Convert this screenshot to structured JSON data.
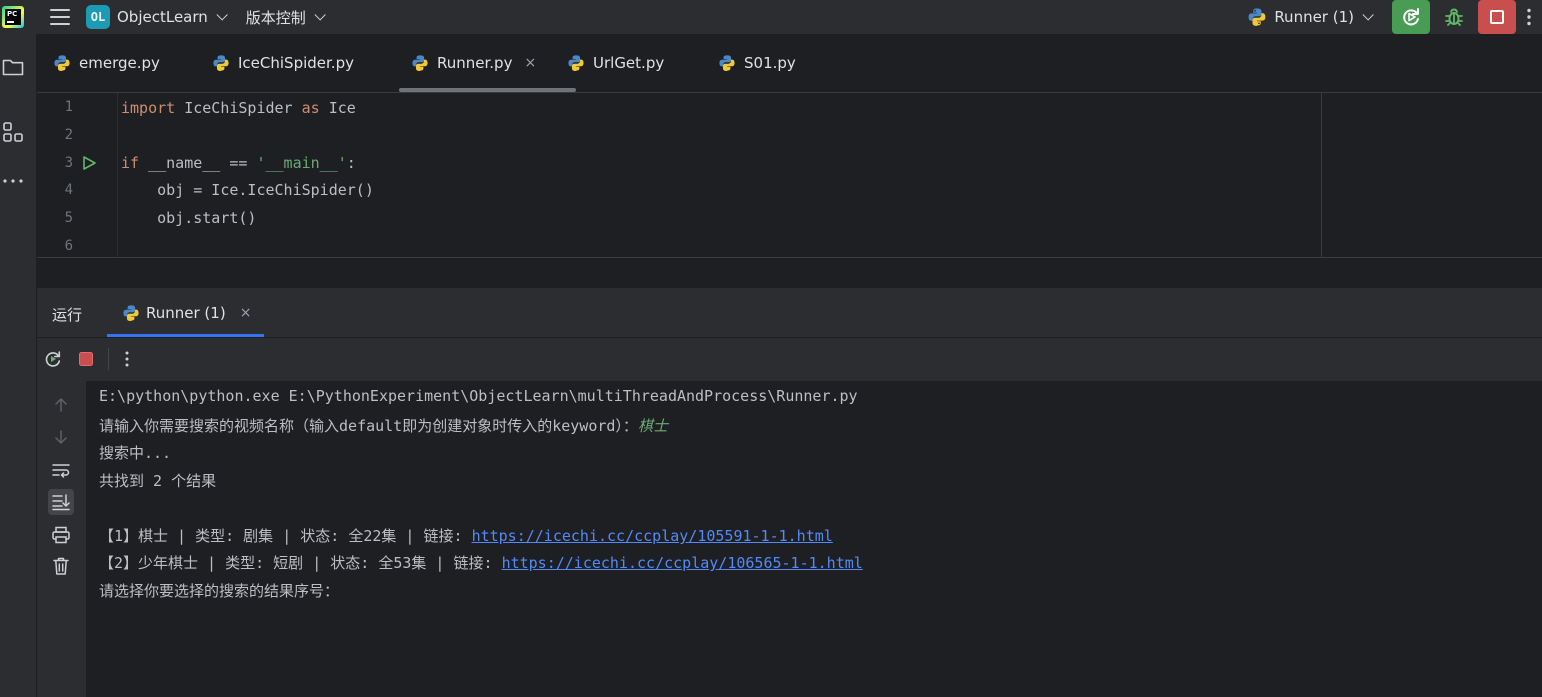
{
  "titlebar": {
    "project_badge": "OL",
    "project_name": "ObjectLearn",
    "vcs_label": "版本控制",
    "run_config": "Runner (1)"
  },
  "tabs": [
    {
      "label": "emerge.py",
      "active": false
    },
    {
      "label": "IceChiSpider.py",
      "active": false
    },
    {
      "label": "Runner.py",
      "active": true,
      "close": "×"
    },
    {
      "label": "UrlGet.py",
      "active": false
    },
    {
      "label": "S01.py",
      "active": false
    }
  ],
  "editor": {
    "line_numbers": [
      "1",
      "2",
      "3",
      "4",
      "5",
      "6"
    ],
    "lines": {
      "l1_kw1": "import",
      "l1_rest": " IceChiSpider ",
      "l1_kw2": "as",
      "l1_tail": " Ice",
      "l3_kw": "if",
      "l3_mid": " __name__ == ",
      "l3_str": "'__main__'",
      "l3_tail": ":",
      "l4": "    obj = Ice.IceChiSpider()",
      "l5": "    obj.start()"
    }
  },
  "run_panel": {
    "title": "运行",
    "tab_label": "Runner (1)",
    "tab_close": "×"
  },
  "console": {
    "line1": "E:\\python\\python.exe E:\\PythonExperiment\\ObjectLearn\\multiThreadAndProcess\\Runner.py",
    "line2_prompt": "请输入你需要搜索的视频名称（输入default即为创建对象时传入的keyword）：",
    "line2_input": "棋士",
    "line3": "搜索中...",
    "line4": "共找到 2 个结果",
    "line6_text": "【1】棋士 | 类型: 剧集 | 状态: 全22集 | 链接: ",
    "line6_link": "https://icechi.cc/ccplay/105591-1-1.html",
    "line7_text": "【2】少年棋士 | 类型: 短剧 | 状态: 全53集 | 链接: ",
    "line7_link": "https://icechi.cc/ccplay/106565-1-1.html",
    "line8": "请选择你要选择的搜索的结果序号："
  },
  "colors": {
    "bg": "#1e1f22",
    "panel": "#2b2d30",
    "keyword": "#cf8e6d",
    "string": "#6aab73",
    "link": "#548af7",
    "rerun_green": "#499c54",
    "stop_red": "#c94f4f",
    "accent_blue": "#3574f0"
  },
  "icons": [
    "pycharm-logo",
    "hamburger-icon",
    "python-icon",
    "rerun-icon",
    "debug-icon",
    "stop-icon",
    "more-vertical-icon",
    "folder-icon",
    "structure-icon",
    "more-horizontal-icon",
    "arrow-up-icon",
    "arrow-down-icon",
    "soft-wrap-icon",
    "scroll-to-end-icon",
    "print-icon",
    "trash-icon",
    "run-gutter-icon"
  ]
}
